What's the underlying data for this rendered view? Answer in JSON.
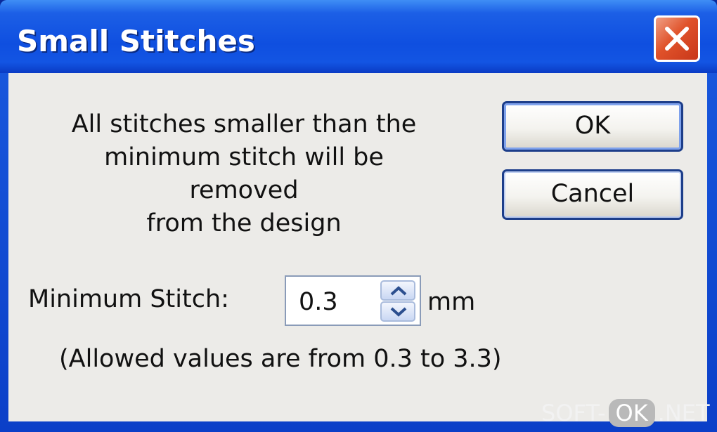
{
  "window": {
    "title": "Small Stitches",
    "close_icon": "close-icon"
  },
  "dialog": {
    "message_lines": [
      "All stitches smaller than the",
      "minimum stitch will be removed",
      "from the design"
    ],
    "ok_label": "OK",
    "cancel_label": "Cancel",
    "min_stitch": {
      "label": "Minimum Stitch:",
      "value": "0.3",
      "unit": "mm",
      "up_icon": "chevron-up-icon",
      "down_icon": "chevron-down-icon"
    },
    "hint": "(Allowed values are from 0.3 to 3.3)"
  },
  "watermark": {
    "prefix": "SOFT-",
    "boxed": "OK",
    "suffix": ".NET"
  },
  "colors": {
    "title_bar": "#1c5fe6",
    "close_button": "#e0522a",
    "client_bg": "#ecebe8",
    "button_border": "#1d3e8a"
  }
}
